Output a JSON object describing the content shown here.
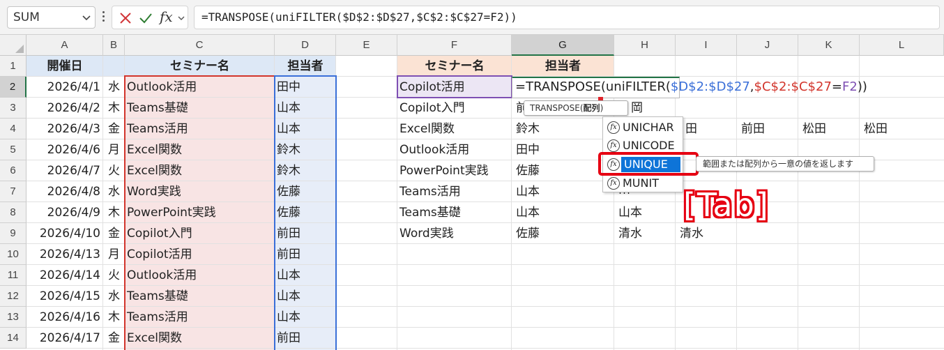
{
  "formula_bar": {
    "name_box": "SUM",
    "formula": "=TRANSPOSE(uniFILTER($D$2:$D$27,$C$2:$C$27=F2))",
    "icons": [
      "chevron-down-icon",
      "more-vert-icon",
      "cancel-x-icon",
      "enter-check-icon",
      "insert-function-icon"
    ]
  },
  "columns": [
    "A",
    "B",
    "C",
    "D",
    "E",
    "F",
    "G",
    "H",
    "I",
    "J",
    "K",
    "L"
  ],
  "rows": [
    "1",
    "2",
    "3",
    "4",
    "5",
    "6",
    "7",
    "8",
    "9",
    "10",
    "11",
    "12",
    "13",
    "14"
  ],
  "table": {
    "headers": {
      "date": "開催日",
      "seminar": "セミナー名",
      "person": "担当者"
    },
    "rows": [
      {
        "date": "2026/4/1",
        "day": "水",
        "seminar": "Outlook活用",
        "person": "田中"
      },
      {
        "date": "2026/4/2",
        "day": "木",
        "seminar": "Teams基礎",
        "person": "山本"
      },
      {
        "date": "2026/4/3",
        "day": "金",
        "seminar": "Teams活用",
        "person": "山本"
      },
      {
        "date": "2026/4/6",
        "day": "月",
        "seminar": "Excel関数",
        "person": "鈴木"
      },
      {
        "date": "2026/4/7",
        "day": "火",
        "seminar": "Excel関数",
        "person": "鈴木"
      },
      {
        "date": "2026/4/8",
        "day": "水",
        "seminar": "Word実践",
        "person": "佐藤"
      },
      {
        "date": "2026/4/9",
        "day": "木",
        "seminar": "PowerPoint実践",
        "person": "佐藤"
      },
      {
        "date": "2026/4/10",
        "day": "金",
        "seminar": "Copilot入門",
        "person": "前田"
      },
      {
        "date": "2026/4/13",
        "day": "月",
        "seminar": "Copilot活用",
        "person": "前田"
      },
      {
        "date": "2026/4/14",
        "day": "火",
        "seminar": "Outlook活用",
        "person": "山本"
      },
      {
        "date": "2026/4/15",
        "day": "水",
        "seminar": "Teams基礎",
        "person": "山本"
      },
      {
        "date": "2026/4/16",
        "day": "木",
        "seminar": "Teams活用",
        "person": "山本"
      },
      {
        "date": "2026/4/17",
        "day": "金",
        "seminar": "Excel関数",
        "person": "前田"
      }
    ]
  },
  "result": {
    "headers": {
      "seminar": "セミナー名",
      "person": "担当者"
    },
    "seminars": [
      "Copilot活用",
      "Copilot入門",
      "Excel関数",
      "Outlook活用",
      "PowerPoint実践",
      "Teams活用",
      "Teams基礎",
      "Word実践"
    ],
    "persons_g": [
      "",
      "前",
      "鈴木",
      "田中",
      "佐藤",
      "山本",
      "山本",
      "佐藤"
    ],
    "persons_h": [
      "",
      "岡",
      "",
      "",
      "",
      "山",
      "山本",
      "清水"
    ],
    "persons_i": [
      "",
      "",
      "田",
      "",
      "",
      "",
      "",
      "清水"
    ],
    "persons_j": [
      "",
      "",
      "前田",
      "",
      "",
      "",
      "",
      ""
    ],
    "persons_k": [
      "",
      "",
      "松田",
      "",
      "",
      "",
      "",
      ""
    ],
    "persons_l": [
      "",
      "",
      "松田",
      "",
      "",
      "",
      "",
      ""
    ]
  },
  "editor": {
    "typed": "=TRANSPOSE(uni",
    "rest_head": "FILTER(",
    "ref1": "$D$2:$D$27",
    "comma": ",",
    "ref2": "$C$2:$C$27",
    "eq": "=",
    "ref3": "F2",
    "close": "))",
    "tooltip_func": "TRANSPOSE(",
    "tooltip_arg": "配列",
    "tooltip_close": ")",
    "autocomplete": [
      "UNICHAR",
      "UNICODE",
      "UNIQUE",
      "MUNIT"
    ],
    "selected": "UNIQUE",
    "description": "範囲または配列から一意の値を返します",
    "icon_glyph": "fx"
  },
  "annotation": "[Tab]",
  "colors": {
    "ref_blue": "#3a6fd8",
    "ref_red": "#d2352c",
    "ref_purple": "#7e4fb3",
    "highlight_red": "#e60012",
    "selection_blue": "#0e74d8"
  }
}
